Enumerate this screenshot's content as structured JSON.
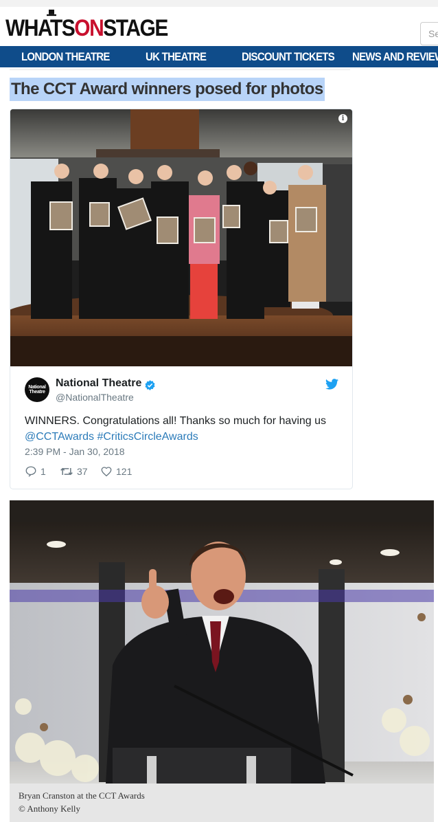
{
  "header": {
    "logo": {
      "part1": "WHATS",
      "part2": "ON",
      "part3": "STAGE"
    },
    "search_placeholder": "Se"
  },
  "nav": {
    "items": [
      "LONDON THEATRE",
      "UK THEATRE",
      "DISCOUNT TICKETS",
      "NEWS AND REVIEWS"
    ]
  },
  "article": {
    "heading": "The CCT Award winners posed for photos",
    "tweet": {
      "avatar_text": "National Theatre",
      "name": "National Theatre",
      "handle": "@NationalTheatre",
      "text": "WINNERS. Congratulations all! Thanks so much for having us",
      "hashtag_line": "@CCTAwards #CriticsCircleAwards",
      "timestamp": "2:39 PM - Jan 30, 2018",
      "replies": "1",
      "retweets": "37",
      "likes": "121",
      "verified_color": "#1da1f2",
      "link_color": "#2b7bb9"
    },
    "photo_caption": "Bryan Cranston at the CCT Awards",
    "photo_credit": "© Anthony Kelly"
  },
  "colors": {
    "nav_bg": "#0f4c8a",
    "logo_accent": "#c8102e",
    "highlight": "#b8d4f8"
  }
}
